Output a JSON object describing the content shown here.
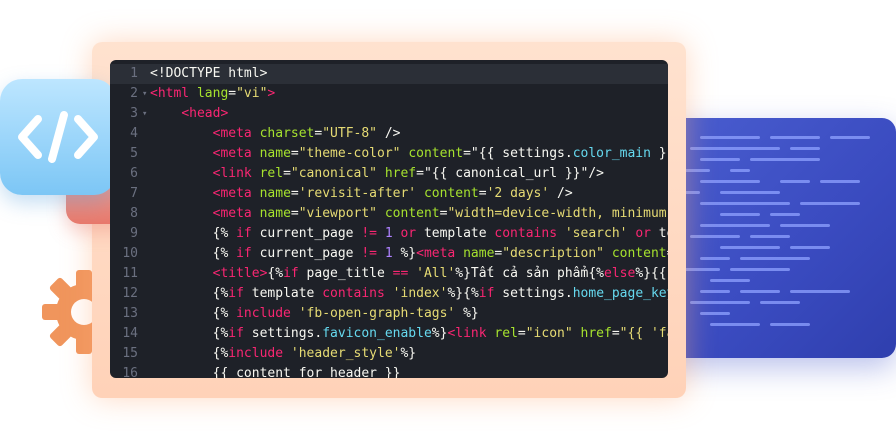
{
  "icon_tile": {
    "label": "</>"
  },
  "decor": {
    "gear_icon": "gear-icon",
    "code_icon": "code-tag-icon"
  },
  "colors": {
    "frame": "#ffd9c3",
    "editor_bg": "#1e2128",
    "blue_panel": "#3a4bc0",
    "gear": "#f0955c"
  },
  "editor": {
    "lines": [
      {
        "n": "1",
        "fold": "",
        "parts": [
          [
            "t-txt",
            "<!DOCTYPE html>"
          ]
        ]
      },
      {
        "n": "2",
        "fold": "▾",
        "parts": [
          [
            "t-tag",
            "<html "
          ],
          [
            "t-attr",
            "lang"
          ],
          [
            "t-txt",
            "="
          ],
          [
            "t-str",
            "\"vi\""
          ],
          [
            "t-tag",
            ">"
          ]
        ]
      },
      {
        "n": "3",
        "fold": "▾",
        "parts": [
          [
            "t-txt",
            "    "
          ],
          [
            "t-tag",
            "<head>"
          ]
        ]
      },
      {
        "n": "4",
        "fold": "",
        "parts": [
          [
            "t-txt",
            "        "
          ],
          [
            "t-tag",
            "<meta "
          ],
          [
            "t-attr",
            "charset"
          ],
          [
            "t-txt",
            "="
          ],
          [
            "t-str",
            "\"UTF-8\""
          ],
          [
            "t-txt",
            " />"
          ]
        ]
      },
      {
        "n": "5",
        "fold": "",
        "parts": [
          [
            "t-txt",
            "        "
          ],
          [
            "t-tag",
            "<meta "
          ],
          [
            "t-attr",
            "name"
          ],
          [
            "t-txt",
            "="
          ],
          [
            "t-str",
            "\"theme-color\""
          ],
          [
            "t-txt",
            " "
          ],
          [
            "t-attr",
            "content"
          ],
          [
            "t-txt",
            "=\"{{ settings."
          ],
          [
            "t-fn",
            "color_main"
          ],
          [
            "t-txt",
            " }}"
          ]
        ]
      },
      {
        "n": "6",
        "fold": "",
        "parts": [
          [
            "t-txt",
            "        "
          ],
          [
            "t-tag",
            "<link "
          ],
          [
            "t-attr",
            "rel"
          ],
          [
            "t-txt",
            "="
          ],
          [
            "t-str",
            "\"canonical\""
          ],
          [
            "t-txt",
            " "
          ],
          [
            "t-attr",
            "href"
          ],
          [
            "t-txt",
            "=\"{{ canonical_url }}\"/>"
          ]
        ]
      },
      {
        "n": "7",
        "fold": "",
        "parts": [
          [
            "t-txt",
            "        "
          ],
          [
            "t-tag",
            "<meta "
          ],
          [
            "t-attr",
            "name"
          ],
          [
            "t-txt",
            "="
          ],
          [
            "t-str",
            "'revisit-after'"
          ],
          [
            "t-txt",
            " "
          ],
          [
            "t-attr",
            "content"
          ],
          [
            "t-txt",
            "="
          ],
          [
            "t-str",
            "'2 days'"
          ],
          [
            "t-txt",
            " />"
          ]
        ]
      },
      {
        "n": "8",
        "fold": "",
        "parts": [
          [
            "t-txt",
            "        "
          ],
          [
            "t-tag",
            "<meta "
          ],
          [
            "t-attr",
            "name"
          ],
          [
            "t-txt",
            "="
          ],
          [
            "t-str",
            "\"viewport\""
          ],
          [
            "t-txt",
            " "
          ],
          [
            "t-attr",
            "content"
          ],
          [
            "t-txt",
            "="
          ],
          [
            "t-str",
            "\"width=device-width, minimum-"
          ]
        ]
      },
      {
        "n": "9",
        "fold": "",
        "parts": [
          [
            "t-txt",
            "        {% "
          ],
          [
            "t-kw",
            "if"
          ],
          [
            "t-txt",
            " current_page "
          ],
          [
            "t-kw",
            "!="
          ],
          [
            "t-txt",
            " "
          ],
          [
            "t-num",
            "1"
          ],
          [
            "t-txt",
            " "
          ],
          [
            "t-kw",
            "or"
          ],
          [
            "t-txt",
            " template "
          ],
          [
            "t-kw",
            "contains"
          ],
          [
            "t-txt",
            " "
          ],
          [
            "t-str",
            "'search'"
          ],
          [
            "t-txt",
            " "
          ],
          [
            "t-kw",
            "or"
          ],
          [
            "t-txt",
            " te"
          ]
        ]
      },
      {
        "n": "10",
        "fold": "",
        "parts": [
          [
            "t-txt",
            "        {% "
          ],
          [
            "t-kw",
            "if"
          ],
          [
            "t-txt",
            " current_page "
          ],
          [
            "t-kw",
            "!="
          ],
          [
            "t-txt",
            " "
          ],
          [
            "t-num",
            "1"
          ],
          [
            "t-txt",
            " %}"
          ],
          [
            "t-tag",
            "<meta "
          ],
          [
            "t-attr",
            "name"
          ],
          [
            "t-txt",
            "="
          ],
          [
            "t-str",
            "\"description\""
          ],
          [
            "t-txt",
            " "
          ],
          [
            "t-attr",
            "content"
          ],
          [
            "t-txt",
            "="
          ]
        ]
      },
      {
        "n": "11",
        "fold": "",
        "parts": [
          [
            "t-txt",
            "        "
          ],
          [
            "t-tag",
            "<title>"
          ],
          [
            "t-txt",
            "{%"
          ],
          [
            "t-kw",
            "if"
          ],
          [
            "t-txt",
            " page_title "
          ],
          [
            "t-kw",
            "=="
          ],
          [
            "t-txt",
            " "
          ],
          [
            "t-str",
            "'All'"
          ],
          [
            "t-txt",
            "%}Tất cả sản phẩm{%"
          ],
          [
            "t-kw",
            "else"
          ],
          [
            "t-txt",
            "%}{{"
          ]
        ]
      },
      {
        "n": "12",
        "fold": "",
        "parts": [
          [
            "t-txt",
            "        {%"
          ],
          [
            "t-kw",
            "if"
          ],
          [
            "t-txt",
            " template "
          ],
          [
            "t-kw",
            "contains"
          ],
          [
            "t-txt",
            " "
          ],
          [
            "t-str",
            "'index'"
          ],
          [
            "t-txt",
            "%}{%"
          ],
          [
            "t-kw",
            "if"
          ],
          [
            "t-txt",
            " settings."
          ],
          [
            "t-fn",
            "home_page_key"
          ]
        ]
      },
      {
        "n": "13",
        "fold": "",
        "parts": [
          [
            "t-txt",
            "        {% "
          ],
          [
            "t-kw",
            "include"
          ],
          [
            "t-txt",
            " "
          ],
          [
            "t-str",
            "'fb-open-graph-tags'"
          ],
          [
            "t-txt",
            " %}"
          ]
        ]
      },
      {
        "n": "14",
        "fold": "",
        "parts": [
          [
            "t-txt",
            "        {%"
          ],
          [
            "t-kw",
            "if"
          ],
          [
            "t-txt",
            " settings."
          ],
          [
            "t-fn",
            "favicon_enable"
          ],
          [
            "t-txt",
            "%}"
          ],
          [
            "t-tag",
            "<link "
          ],
          [
            "t-attr",
            "rel"
          ],
          [
            "t-txt",
            "="
          ],
          [
            "t-str",
            "\"icon\""
          ],
          [
            "t-txt",
            " "
          ],
          [
            "t-attr",
            "href"
          ],
          [
            "t-txt",
            "="
          ],
          [
            "t-str",
            "\"{{ 'fa"
          ]
        ]
      },
      {
        "n": "15",
        "fold": "",
        "parts": [
          [
            "t-txt",
            "        {%"
          ],
          [
            "t-kw",
            "include"
          ],
          [
            "t-txt",
            " "
          ],
          [
            "t-str",
            "'header_style'"
          ],
          [
            "t-txt",
            "%}"
          ]
        ]
      },
      {
        "n": "16",
        "fold": "",
        "parts": [
          [
            "t-txt",
            "        {{ content_for_header }}"
          ]
        ]
      }
    ]
  }
}
